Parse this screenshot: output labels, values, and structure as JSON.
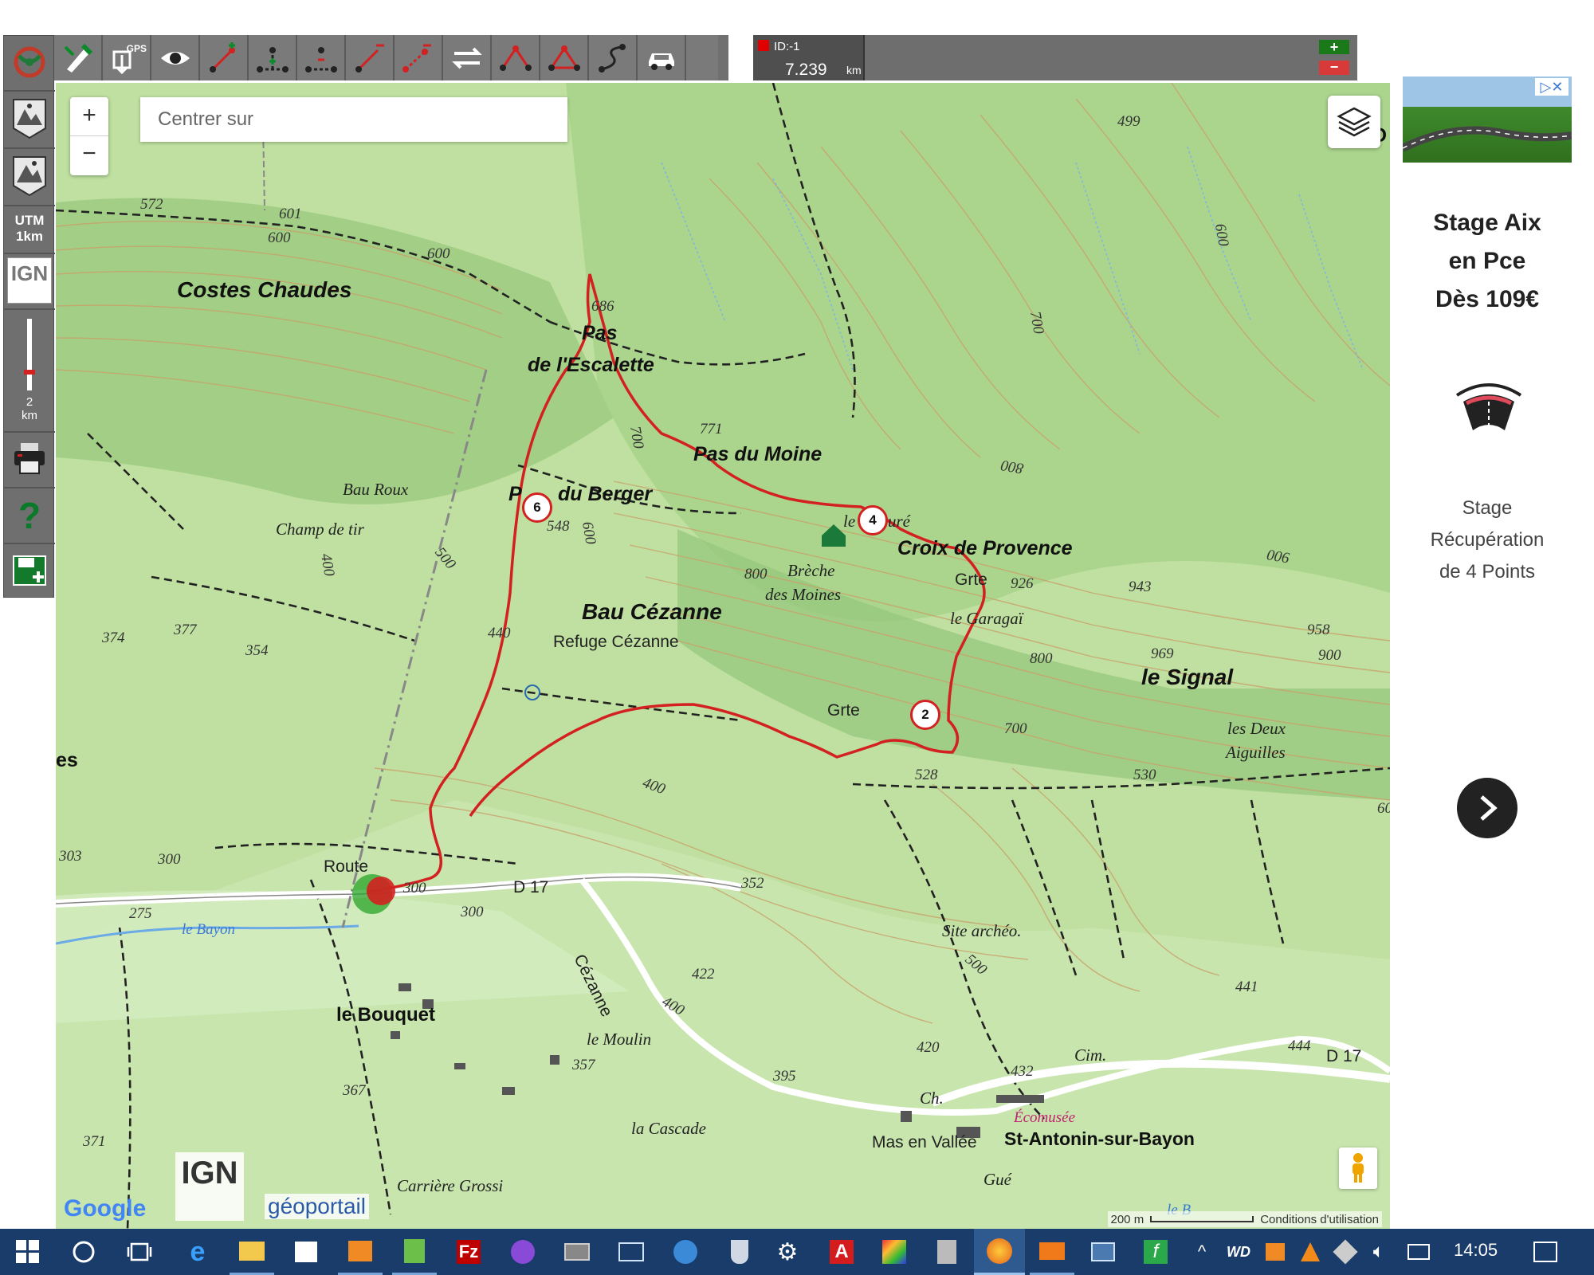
{
  "left_toolbar": {
    "utm_label": "UTM",
    "utm_scale": "1km",
    "ign_label": "IGN",
    "slider_value": "2",
    "slider_unit": "km",
    "help_label": "?"
  },
  "top_toolbar": {
    "gps_label": "GPS"
  },
  "track_info": {
    "id_label": "ID:-1",
    "distance_value": "7.239",
    "distance_unit": "km",
    "add_label": "+",
    "remove_label": "−"
  },
  "map": {
    "search_placeholder": "Centrer sur",
    "zoom_in_label": "+",
    "zoom_out_label": "−",
    "scale_label": "200 m",
    "terms_label": "Conditions d'utilisation",
    "google_label": "Google",
    "ign_logo_label": "IGN",
    "geoportail_label": "géoportail",
    "labels": {
      "costes_chaudes": "Costes Chaudes",
      "pas_escalette_1": "Pas",
      "pas_escalette_2": "de l'Escalette",
      "pas_moine": "Pas du Moine",
      "pas_berger_a": "P",
      "pas_berger_b": "du Berger",
      "bau_roux": "Bau Roux",
      "champ_tir": "Champ de tir",
      "bau_cezanne": "Bau Cézanne",
      "refuge": "Refuge Cézanne",
      "breche_1": "Brèche",
      "breche_2": "des Moines",
      "croix": "Croix de Provence",
      "le_cure_a": "le",
      "le_cure_b": "uré",
      "grte1": "Grte",
      "grte2": "Grte",
      "garagai": "le Garagaï",
      "signal": "le Signal",
      "deux_aig_1": "les Deux",
      "deux_aig_2": "Aiguilles",
      "route": "Route",
      "d17a": "D 17",
      "d17b": "D 17",
      "cezanne_road": "Cézanne",
      "le_bayon": "le Bayon",
      "le_bayon2": "le B",
      "bouquet": "le Bouquet",
      "moulin": "le Moulin",
      "cascade": "la Cascade",
      "site_archeo": "Site archéo.",
      "cim": "Cim.",
      "ch": "Ch.",
      "ecomusee": "Écomusée",
      "st_antonin": "St-Antonin-sur-Bayon",
      "mas": "Mas en Vallée",
      "gue": "Gué",
      "carriere": "Carrière Grossi",
      "edge_d": "D",
      "edge_es": "es"
    },
    "elevations": {
      "e572": "572",
      "e601": "601",
      "e600a": "600",
      "e600b": "600",
      "e686": "686",
      "e771": "771",
      "e700a": "700",
      "e700b": "700",
      "e700c": "700",
      "e800a": "800",
      "e800b": "800",
      "e800c": "800",
      "e499": "499",
      "e600c": "600",
      "e900a": "900",
      "e900b": "900",
      "e926": "926",
      "e943": "943",
      "e969": "969",
      "e958": "958",
      "e548": "548",
      "e600d": "600",
      "e500a": "500",
      "e500b": "500",
      "e400a": "400",
      "e400b": "400",
      "e400c": "400",
      "e440": "440",
      "e374": "374",
      "e377": "377",
      "e354": "354",
      "e528": "528",
      "e530": "530",
      "e303": "303",
      "e300a": "300",
      "e300b": "300",
      "e300c": "300",
      "e275": "275",
      "e352": "352",
      "e422": "422",
      "e420": "420",
      "e432": "432",
      "e395": "395",
      "e357": "357",
      "e367": "367",
      "e371": "371",
      "e441": "441",
      "e444": "444",
      "e60": "60"
    },
    "markers": [
      "6",
      "4",
      "2"
    ],
    "track_color": "#d32020",
    "terrain_color": "#b9dd9c"
  },
  "ad": {
    "title_1": "Stage Aix",
    "title_2": "en Pce",
    "title_3": "Dès 109€",
    "desc_1": "Stage",
    "desc_2": "Récupération",
    "desc_3": "de 4 Points"
  },
  "taskbar": {
    "clock": "14:05",
    "icons": [
      "windows-start-icon",
      "cortana-icon",
      "task-view-icon",
      "edge-icon",
      "file-explorer-icon",
      "store-icon",
      "media-icon",
      "editor-icon",
      "filezilla-icon",
      "nvu-icon",
      "film-icon",
      "monitor-icon",
      "globe-icon",
      "shield-icon",
      "settings-icon",
      "acrobat-icon",
      "paint-icon",
      "calculator-icon",
      "firefox-icon",
      "mail-icon",
      "window-icon",
      "feather-icon"
    ],
    "tray_icons": [
      "chevron-up-icon",
      "wd-icon",
      "printer-tray-icon",
      "vlc-icon",
      "cube-icon",
      "volume-icon",
      "network-icon",
      "notification-icon"
    ]
  }
}
